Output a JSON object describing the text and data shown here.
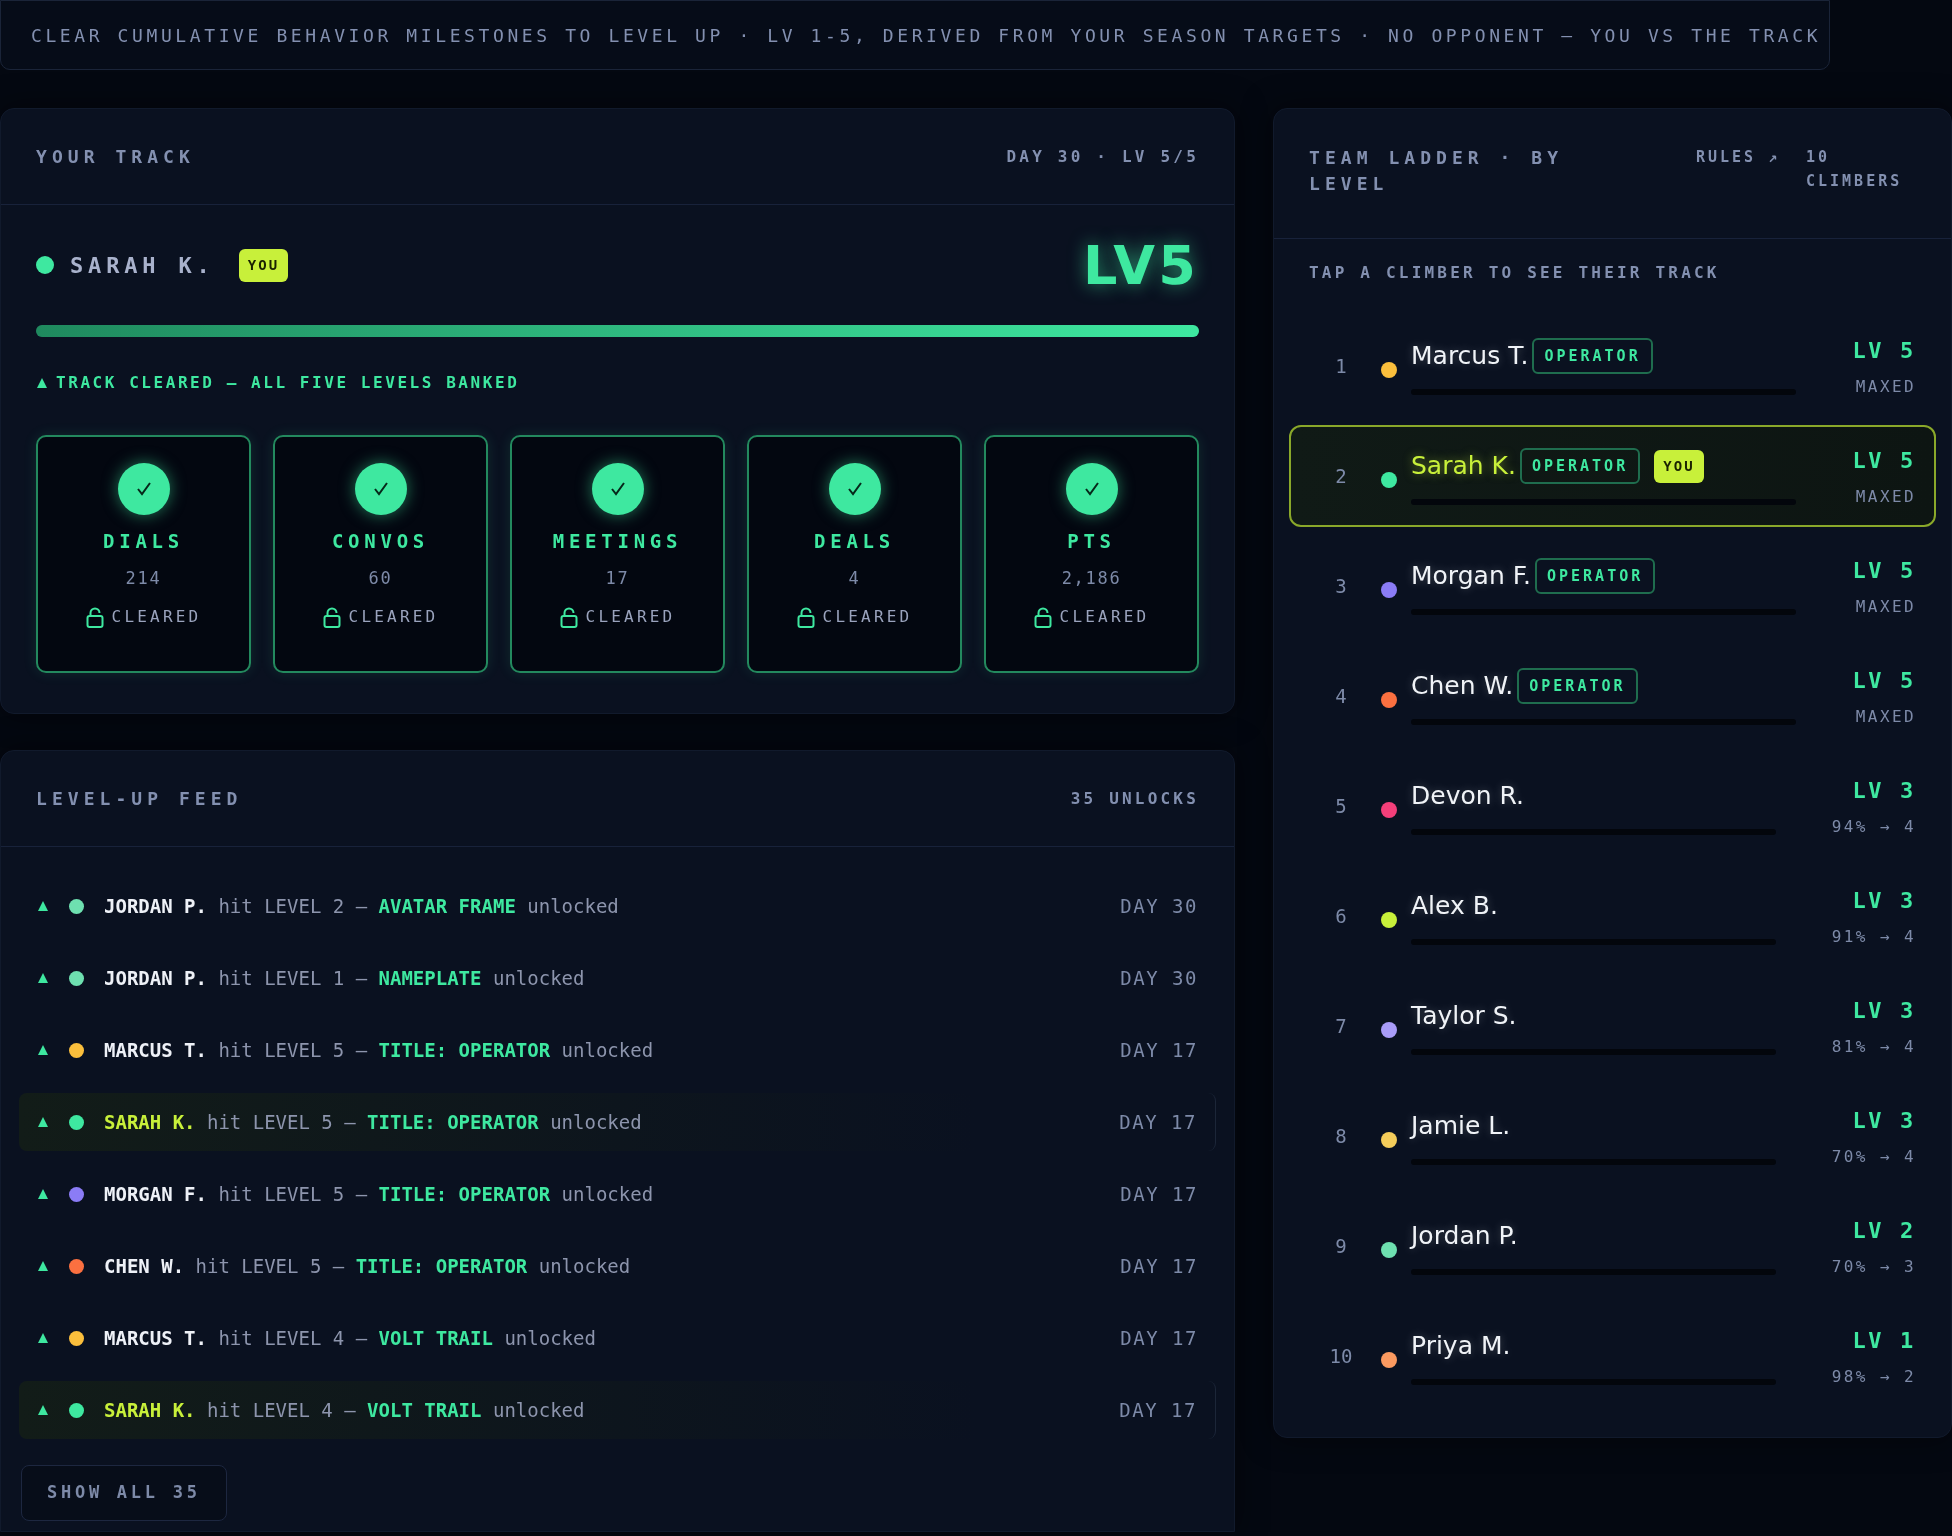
{
  "banner": "CLEAR CUMULATIVE BEHAVIOR MILESTONES TO LEVEL UP · LV 1-5, DERIVED FROM YOUR SEASON TARGETS · NO OPPONENT — YOU VS THE TRACK",
  "track": {
    "title": "YOUR TRACK",
    "meta": "DAY 30 · LV 5/5",
    "player": {
      "name": "SARAH K.",
      "badge": "YOU",
      "color": "#3ee8a0"
    },
    "level_label": "LV5",
    "progress": {
      "level": 1.0
    },
    "status": "TRACK CLEARED — ALL FIVE LEVELS BANKED",
    "milestones": [
      {
        "label": "DIALS",
        "value": "214",
        "status": "CLEARED",
        "cleared": true
      },
      {
        "label": "CONVOS",
        "value": "60",
        "status": "CLEARED",
        "cleared": true
      },
      {
        "label": "MEETINGS",
        "value": "17",
        "status": "CLEARED",
        "cleared": true
      },
      {
        "label": "DEALS",
        "value": "4",
        "status": "CLEARED",
        "cleared": true
      },
      {
        "label": "PTS",
        "value": "2,186",
        "status": "CLEARED",
        "cleared": true
      }
    ]
  },
  "feed": {
    "title": "LEVEL-UP FEED",
    "meta": "35 UNLOCKS",
    "items": [
      {
        "name": "JORDAN P.",
        "action": "hit LEVEL 2 —",
        "reward": "AVATAR FRAME",
        "suffix": "unlocked",
        "day": "DAY 30",
        "color": "#6ee0b0",
        "is_you": false
      },
      {
        "name": "JORDAN P.",
        "action": "hit LEVEL 1 —",
        "reward": "NAMEPLATE",
        "suffix": "unlocked",
        "day": "DAY 30",
        "color": "#6ee0b0",
        "is_you": false
      },
      {
        "name": "MARCUS T.",
        "action": "hit LEVEL 5 —",
        "reward": "TITLE: OPERATOR",
        "suffix": "unlocked",
        "day": "DAY 17",
        "color": "#fbbf3c",
        "is_you": false
      },
      {
        "name": "SARAH K.",
        "action": "hit LEVEL 5 —",
        "reward": "TITLE: OPERATOR",
        "suffix": "unlocked",
        "day": "DAY 17",
        "color": "#3ee8a0",
        "is_you": true
      },
      {
        "name": "MORGAN F.",
        "action": "hit LEVEL 5 —",
        "reward": "TITLE: OPERATOR",
        "suffix": "unlocked",
        "day": "DAY 17",
        "color": "#8b7cf6",
        "is_you": false
      },
      {
        "name": "CHEN W.",
        "action": "hit LEVEL 5 —",
        "reward": "TITLE: OPERATOR",
        "suffix": "unlocked",
        "day": "DAY 17",
        "color": "#fb7040",
        "is_you": false
      },
      {
        "name": "MARCUS T.",
        "action": "hit LEVEL 4 —",
        "reward": "VOLT TRAIL",
        "suffix": "unlocked",
        "day": "DAY 17",
        "color": "#fbbf3c",
        "is_you": false
      },
      {
        "name": "SARAH K.",
        "action": "hit LEVEL 4 —",
        "reward": "VOLT TRAIL",
        "suffix": "unlocked",
        "day": "DAY 17",
        "color": "#3ee8a0",
        "is_you": true
      }
    ],
    "button": "SHOW ALL 35"
  },
  "ladder": {
    "title": "TEAM LADDER · BY LEVEL",
    "rules_link": "RULES ↗",
    "count": "10 CLIMBERS",
    "hint": "TAP A CLIMBER TO SEE THEIR TRACK",
    "rows": [
      {
        "rank": "1",
        "name": "Marcus T.",
        "tag": "OPERATOR",
        "color": "#fbbf3c",
        "level": "LV 5",
        "progress": "MAXED",
        "selected": false
      },
      {
        "rank": "2",
        "name": "Sarah K.",
        "tag": "OPERATOR",
        "badge": "YOU",
        "color": "#3ee8a0",
        "level": "LV 5",
        "progress": "MAXED",
        "selected": true
      },
      {
        "rank": "3",
        "name": "Morgan F.",
        "tag": "OPERATOR",
        "color": "#8b7cf6",
        "level": "LV 5",
        "progress": "MAXED",
        "selected": false
      },
      {
        "rank": "4",
        "name": "Chen W.",
        "tag": "OPERATOR",
        "color": "#fb7040",
        "level": "LV 5",
        "progress": "MAXED",
        "selected": false
      },
      {
        "rank": "5",
        "name": "Devon R.",
        "color": "#f43f7a",
        "level": "LV 3",
        "progress": "94% → 4",
        "selected": false
      },
      {
        "rank": "6",
        "name": "Alex B.",
        "color": "#c8f03a",
        "level": "LV 3",
        "progress": "91% → 4",
        "selected": false
      },
      {
        "rank": "7",
        "name": "Taylor S.",
        "color": "#a99cf8",
        "level": "LV 3",
        "progress": "81% → 4",
        "selected": false
      },
      {
        "rank": "8",
        "name": "Jamie L.",
        "color": "#f5cd5a",
        "level": "LV 3",
        "progress": "70% → 4",
        "selected": false
      },
      {
        "rank": "9",
        "name": "Jordan P.",
        "color": "#6ee0b0",
        "level": "LV 2",
        "progress": "70% → 3",
        "selected": false
      },
      {
        "rank": "10",
        "name": "Priya M.",
        "color": "#fb9a60",
        "level": "LV 1",
        "progress": "98% → 2",
        "selected": false
      }
    ]
  }
}
